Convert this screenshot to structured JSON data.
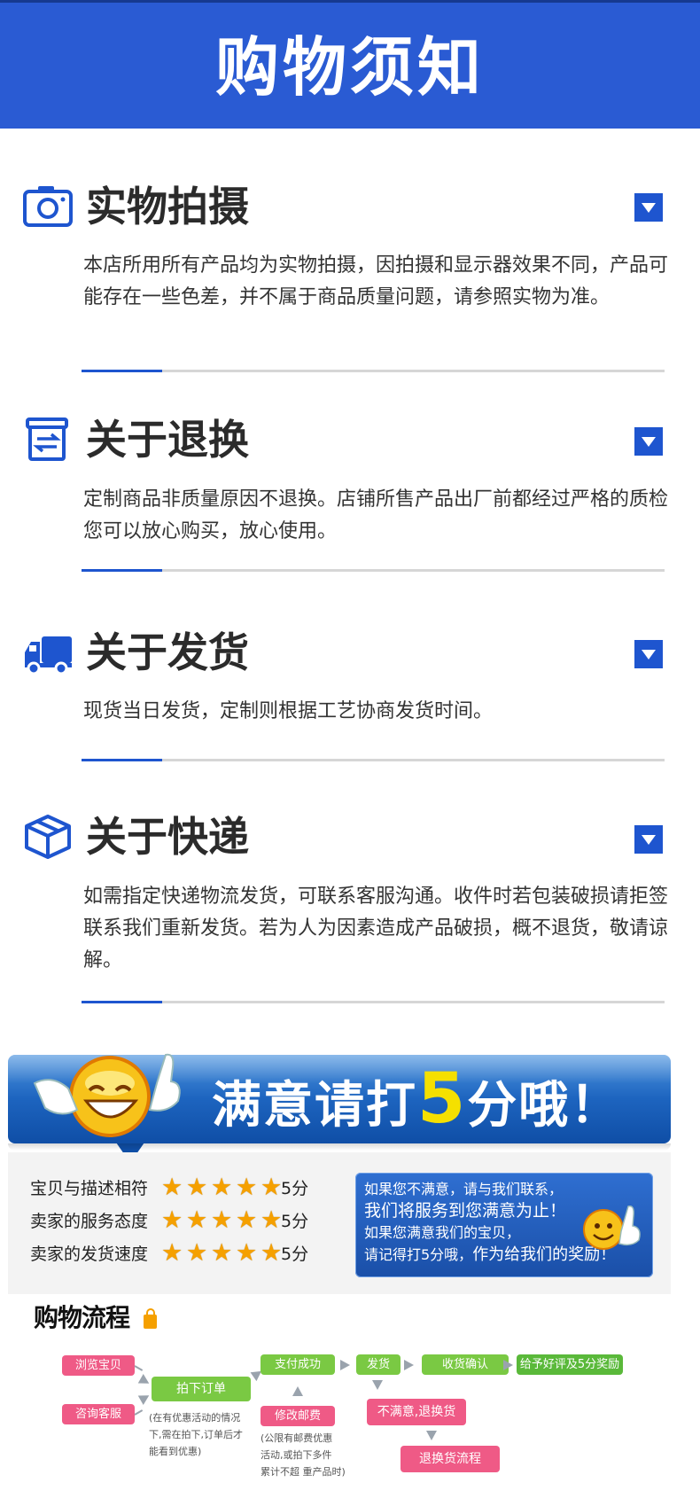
{
  "header": {
    "title": "购物须知"
  },
  "sections": [
    {
      "title": "实物拍摄",
      "icon": "camera-icon",
      "body": "本店所用所有产品均为实物拍摄，因拍摄和显示器效果不同，产品可能存在一些色差，并不属于商品质量问题，请参照实物为准。"
    },
    {
      "title": "关于退换",
      "icon": "exchange-icon",
      "body": "定制商品非质量原因不退换。店铺所售产品出厂前都经过严格的质检您可以放心购买，放心使用。"
    },
    {
      "title": "关于发货",
      "icon": "truck-icon",
      "body": "现货当日发货，定制则根据工艺协商发货时间。"
    },
    {
      "title": "关于快递",
      "icon": "box-icon",
      "body": "如需指定快递物流发货，可联系客服沟通。收件时若包装破损请拒签联系我们重新发货。若为人为因素造成产品破损，概不退货，敬请谅解。"
    }
  ],
  "banner": {
    "text_before": "满意请打",
    "highlight": "5",
    "text_after": "分哦！"
  },
  "ratings": [
    {
      "label": "宝贝与描述相符",
      "stars": 5,
      "score": "5分"
    },
    {
      "label": "卖家的服务态度",
      "stars": 5,
      "score": "5分"
    },
    {
      "label": "卖家的发货速度",
      "stars": 5,
      "score": "5分"
    }
  ],
  "message": {
    "line1": "如果您不满意，请与我们联系，",
    "line2": "我们将服务到您满意为止！",
    "line3": "如果您满意我们的宝贝，",
    "line4_a": "请记得打5分哦，",
    "line4_b": "作为给我们的奖励！"
  },
  "flow": {
    "title": "购物流程",
    "browse": "浏览宝贝",
    "consult": "咨询客服",
    "order": "拍下订单",
    "order_note": [
      "(在有优惠活动的情况",
      "下,需在拍下,订单后才",
      "能看到优惠)"
    ],
    "pay": "支付成功",
    "modify": "修改邮费",
    "modify_note": [
      "(公限有邮费优惠",
      "活动,或拍下多件",
      "累计不超 重产品时)"
    ],
    "ship": "发货",
    "confirm": "收货确认",
    "review": "给予好评及5分奖励",
    "unsatisfied": "不满意,退换货",
    "return_flow": "退换货流程"
  },
  "colors": {
    "brand_blue": "#2a5bd3",
    "accent": "#1e55cf",
    "star": "#f5a000",
    "pink": "#ef5a86",
    "green": "#7ac943"
  }
}
